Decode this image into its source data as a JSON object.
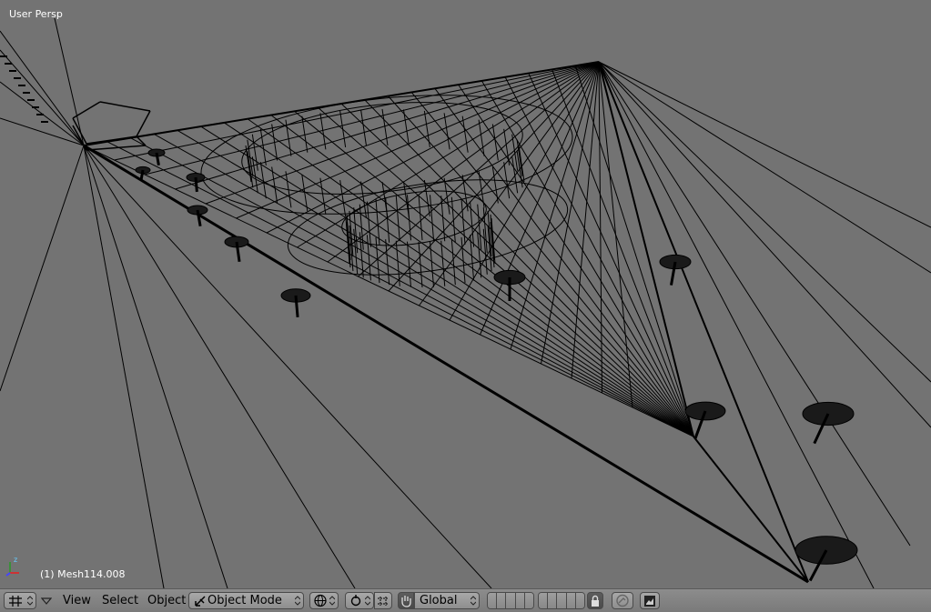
{
  "viewport": {
    "view_name": "User Persp",
    "active_object": "(1) Mesh114.008",
    "background_color": "#737373",
    "wire_color": "#000000"
  },
  "header": {
    "editor_type_icon": "grid-icon",
    "menus": {
      "view": "View",
      "select": "Select",
      "object": "Object"
    },
    "mode": "Object Mode",
    "transform_orientation": "Global",
    "icons": [
      "grid-icon",
      "chevron-down-icon",
      "mode-icon",
      "shading-sphere-icon",
      "pivot-icon",
      "manipulator-icon",
      "hand-icon",
      "layer-grid",
      "lock-icon",
      "proportional-edit-icon",
      "render-icon"
    ]
  }
}
